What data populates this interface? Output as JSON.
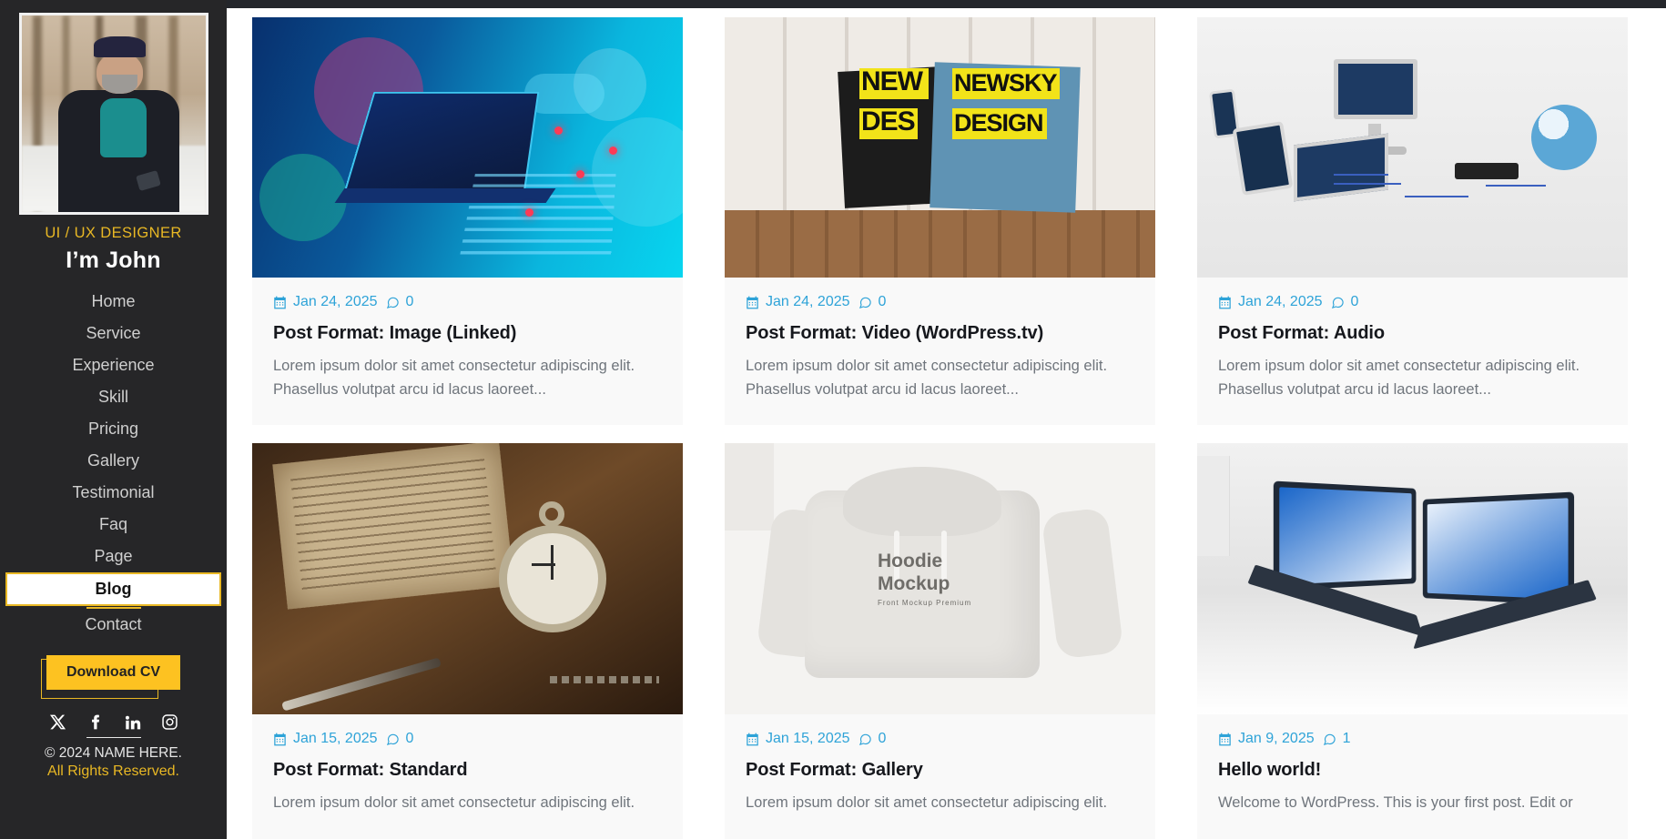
{
  "sidebar": {
    "role": "UI / UX DESIGNER",
    "name": "I’m John",
    "avatar_alt": "profile-photo",
    "nav": [
      {
        "label": "Home",
        "active": false
      },
      {
        "label": "Service",
        "active": false
      },
      {
        "label": "Experience",
        "active": false
      },
      {
        "label": "Skill",
        "active": false
      },
      {
        "label": "Pricing",
        "active": false
      },
      {
        "label": "Gallery",
        "active": false
      },
      {
        "label": "Testimonial",
        "active": false
      },
      {
        "label": "Faq",
        "active": false
      },
      {
        "label": "Page",
        "active": false
      },
      {
        "label": "Blog",
        "active": true
      },
      {
        "label": "Contact",
        "active": false
      }
    ],
    "cv_button": "Download CV",
    "socials": [
      {
        "name": "x-twitter-icon"
      },
      {
        "name": "facebook-icon"
      },
      {
        "name": "linkedin-icon"
      },
      {
        "name": "instagram-icon"
      }
    ],
    "copyright": "© 2024 NAME HERE.",
    "rights": "All Rights Reserved."
  },
  "colors": {
    "sidebar_bg": "#262628",
    "accent_gold": "#e9b824",
    "cv_button": "#fdc221",
    "meta_blue": "#2ea3d8",
    "card_bg": "#f9f9f9",
    "title": "#16181d",
    "excerpt": "#6f757c"
  },
  "posts": [
    {
      "date": "Jan 24, 2025",
      "comments": "0",
      "title": "Post Format: Image (Linked)",
      "excerpt": "Lorem ipsum dolor sit amet consectetur adipiscing elit. Phasellus volutpat arcu id lacus laoreet...",
      "thumb": "tech-illustration"
    },
    {
      "date": "Jan 24, 2025",
      "comments": "0",
      "title": "Post Format: Video (WordPress.tv)",
      "excerpt": "Lorem ipsum dolor sit amet consectetur adipiscing elit. Phasellus volutpat arcu id lacus laoreet...",
      "thumb": "newsky-design-pillows"
    },
    {
      "date": "Jan 24, 2025",
      "comments": "0",
      "title": "Post Format: Audio",
      "excerpt": "Lorem ipsum dolor sit amet consectetur adipiscing elit. Phasellus volutpat arcu id lacus laoreet...",
      "thumb": "devices-network"
    },
    {
      "date": "Jan 15, 2025",
      "comments": "0",
      "title": "Post Format: Standard",
      "excerpt": "Lorem ipsum dolor sit amet consectetur adipiscing elit.",
      "thumb": "vintage-pocket-watch"
    },
    {
      "date": "Jan 15, 2025",
      "comments": "0",
      "title": "Post Format: Gallery",
      "excerpt": "Lorem ipsum dolor sit amet consectetur adipiscing elit.",
      "thumb": "hoodie-mockup"
    },
    {
      "date": "Jan 9, 2025",
      "comments": "1",
      "title": "Hello world!",
      "excerpt": "Welcome to WordPress. This is your first post. Edit or",
      "thumb": "laptops-marketing"
    }
  ],
  "thumb_text": {
    "pillow_line1": "NEW",
    "pillow_line2": "DES",
    "pillow_line3": "NEWSKY",
    "pillow_line4": "DESIGN",
    "hoodie_title": "Hoodie",
    "hoodie_title2": "Mockup",
    "hoodie_sub": "Front Mockup Premium"
  }
}
